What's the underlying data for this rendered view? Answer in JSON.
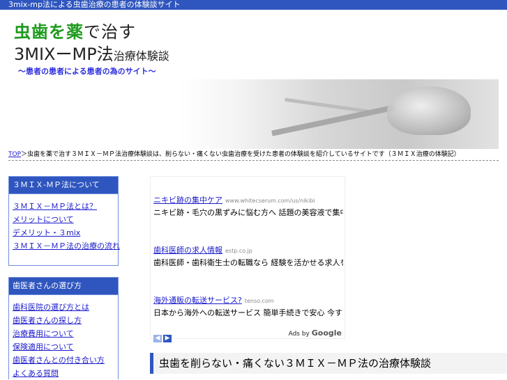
{
  "topbar": {
    "text": "3mix-mp法による虫歯治療の患者の体験談サイト"
  },
  "logo": {
    "line1_green": "虫歯を薬",
    "line1_dark": "で治す",
    "line2_main": "3MIXーMP法",
    "line2_small": "治療体験談",
    "line3": "〜患者の患者による患者の為のサイト〜"
  },
  "breadcrumb": {
    "link": "TOP",
    "text": "＞虫歯を薬で治す３ＭＩＸ－ＭＰ法治療体験談は、削らない・痛くない虫歯治療を受けた患者の体験談を紹介しているサイトです（３ＭＩＸ治療の体験記）"
  },
  "sidebar": {
    "box1": {
      "title": "３ＭＩＸ-ＭＰ法について",
      "items": [
        "３ＭＩＸ－ＭＰ法とは？",
        "メリットについて",
        "デメリット・３mix",
        "３ＭＩＸ－ＭＰ法の治療の流れ"
      ]
    },
    "box2": {
      "title": "歯医者さんの選び方",
      "items": [
        "歯科医院の選び方とは",
        "歯医者さんの探し方",
        "治療費用について",
        "保険適用について",
        "歯医者さんとの付き合い方",
        "よくある質問"
      ]
    }
  },
  "ads": {
    "items": [
      {
        "title": "ニキビ跡の集中ケア",
        "url": "www.whitecserum.com/us/nikibi",
        "desc": "ニキビ跡・毛穴の黒ずみに悩む方へ 話題の美容液で集中ケアしましょう"
      },
      {
        "title": "歯科医師の求人情報",
        "url": "estp.co.jp",
        "desc": "歯科医師・歯科衛生士の転職なら 経験を活かせる求人を多数掲載中"
      },
      {
        "title": "海外通販の転送サービス?",
        "url": "tenso.com",
        "desc": "日本から海外への転送サービス 簡単手続きで安心 今すぐ登録"
      }
    ],
    "ads_by_prefix": "Ads by ",
    "ads_by_brand": "Google",
    "prev": "◀",
    "next": "▶"
  },
  "main": {
    "heading": "虫歯を削らない・痛くない３ＭＩＸ－ＭＰ法の治療体験談"
  }
}
